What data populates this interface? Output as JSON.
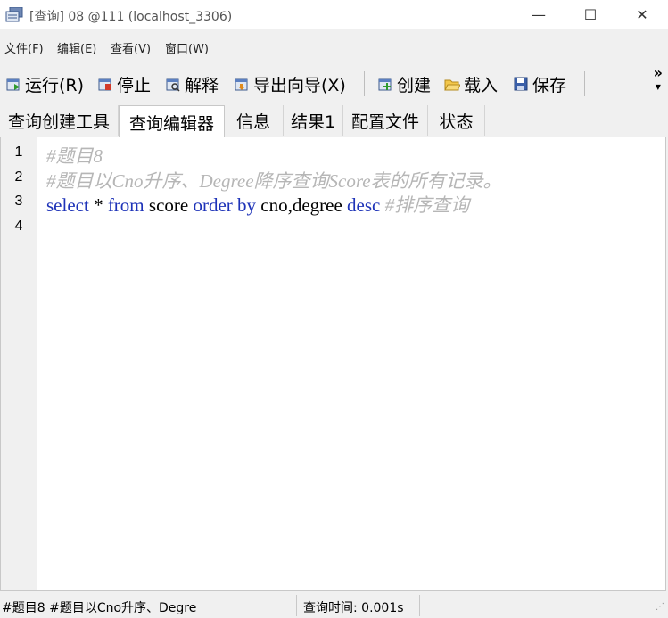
{
  "window": {
    "title": "[查询] 08 @111 (localhost_3306)",
    "controls": {
      "minimize": "—",
      "maximize": "☐",
      "close": "✕"
    }
  },
  "menu": [
    {
      "label": "文件(F)"
    },
    {
      "label": "编辑(E)"
    },
    {
      "label": "查看(V)"
    },
    {
      "label": "窗口(W)"
    }
  ],
  "toolbar": {
    "run": "运行(R)",
    "stop": "停止",
    "explain": "解释",
    "export_wizard": "导出向导(X)",
    "create": "创建",
    "load": "载入",
    "save": "保存",
    "overflow": "»"
  },
  "tabs": [
    {
      "label": "查询创建工具",
      "active": false
    },
    {
      "label": "查询编辑器",
      "active": true
    },
    {
      "label": "信息",
      "active": false
    },
    {
      "label": "结果1",
      "active": false
    },
    {
      "label": "配置文件",
      "active": false
    },
    {
      "label": "状态",
      "active": false
    }
  ],
  "editor": {
    "line_numbers": [
      "1",
      "2",
      "3",
      "4"
    ],
    "line1_comment": "#题目8",
    "line2_comment": "#题目以Cno升序、Degree降序查询Score表的所有记录。",
    "line3": {
      "t1": "select",
      "t2": " * ",
      "t3": "from",
      "t4": " score ",
      "t5": "order by",
      "t6": " cno,degree ",
      "t7": "desc",
      "t8": " #排序查询"
    }
  },
  "status": {
    "sql_preview": "#题目8 #题目以Cno升序、Degre",
    "query_time": "查询时间: 0.001s"
  },
  "colors": {
    "keyword": "#1e33b8",
    "comment": "#b6b6b6",
    "gutter": "#f0f0f0"
  }
}
